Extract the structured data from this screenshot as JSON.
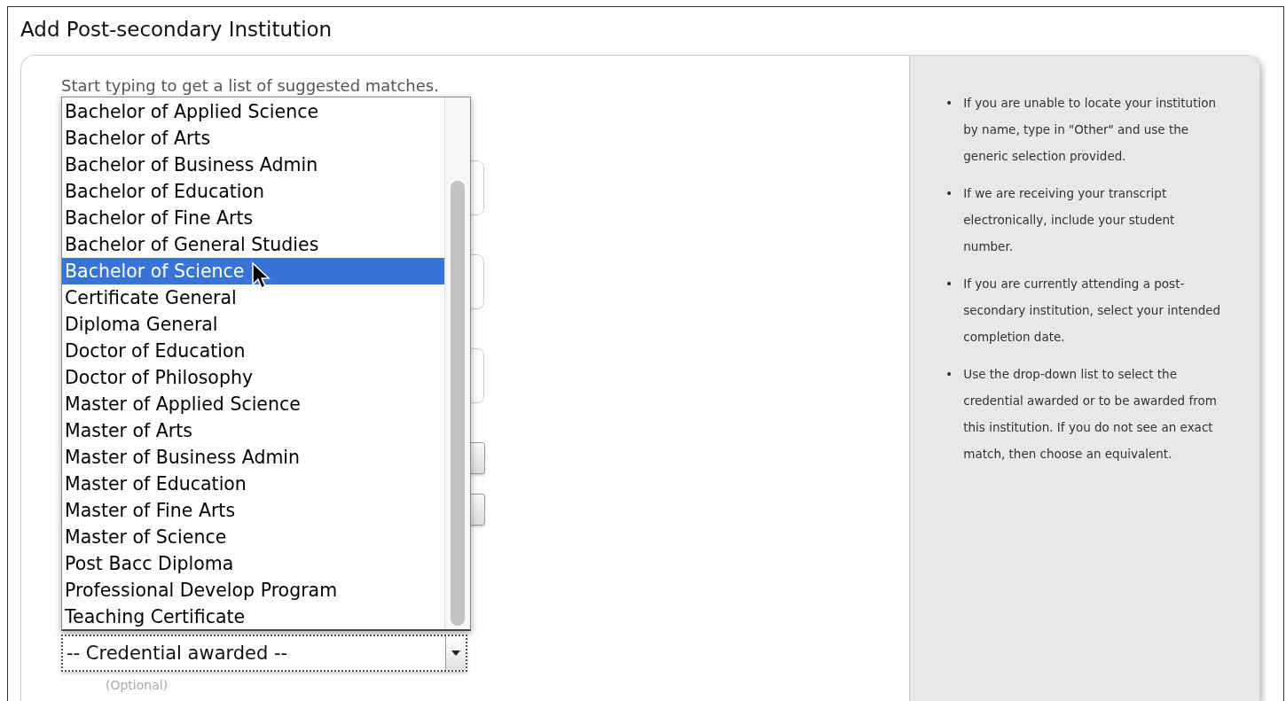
{
  "title": "Add Post-secondary Institution",
  "hint": "Start typing to get a list of suggested matches.",
  "background_fields": [
    {
      "kind": "text"
    },
    {
      "kind": "text"
    },
    {
      "kind": "text"
    },
    {
      "kind": "select"
    },
    {
      "kind": "select"
    }
  ],
  "dropdown": {
    "options": [
      {
        "label": "Bachelor of Applied Science",
        "selected": false
      },
      {
        "label": "Bachelor of Arts",
        "selected": false
      },
      {
        "label": "Bachelor of Business Admin",
        "selected": false
      },
      {
        "label": "Bachelor of Education",
        "selected": false
      },
      {
        "label": "Bachelor of Fine Arts",
        "selected": false
      },
      {
        "label": "Bachelor of General Studies",
        "selected": false
      },
      {
        "label": "Bachelor of Science",
        "selected": true
      },
      {
        "label": "Certificate General",
        "selected": false
      },
      {
        "label": "Diploma General",
        "selected": false
      },
      {
        "label": "Doctor of Education",
        "selected": false
      },
      {
        "label": "Doctor of Philosophy",
        "selected": false
      },
      {
        "label": "Master of Applied Science",
        "selected": false
      },
      {
        "label": "Master of Arts",
        "selected": false
      },
      {
        "label": "Master of Business Admin",
        "selected": false
      },
      {
        "label": "Master of Education",
        "selected": false
      },
      {
        "label": "Master of Fine Arts",
        "selected": false
      },
      {
        "label": "Master of Science",
        "selected": false
      },
      {
        "label": "Post Bacc Diploma",
        "selected": false
      },
      {
        "label": "Professional Develop Program",
        "selected": false
      },
      {
        "label": "Teaching Certificate",
        "selected": false
      }
    ]
  },
  "credential_select": {
    "value": "-- Credential awarded --"
  },
  "optional_note": "(Optional)",
  "tips": [
    {
      "marker": "•",
      "text": "If you are unable to locate your institution by name, type in \"Other\" and use the generic selection provided."
    },
    {
      "marker": "•",
      "text": "If we are receiving your transcript electronically, include your student number."
    },
    {
      "marker": "•",
      "text": "If you are currently attending a post-secondary institution, select your intended completion date."
    },
    {
      "marker": "•",
      "text": "Use the drop-down list to select the credential awarded or to be awarded from this institution. If you do not see an exact match, then choose an equivalent."
    }
  ]
}
